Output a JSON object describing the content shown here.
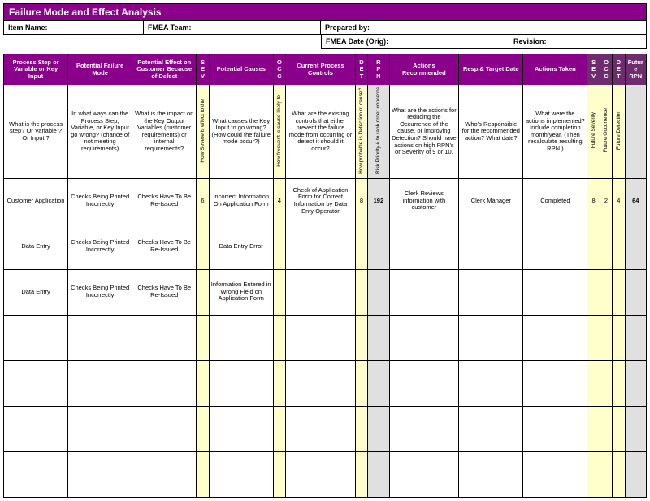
{
  "title": "Failure Mode and Effect Analysis",
  "info": {
    "item_name": "Item Name:",
    "team": "FMEA Team:",
    "prepared": "Prepared by:",
    "date": "FMEA Date (Orig):",
    "revision": "Revision:"
  },
  "headers": {
    "step": "Process Step or Variable or Key Input",
    "failure": "Potential Failure Mode",
    "effect": "Potential Effect on Customer Because of Defect",
    "sev": "S\nE\nV",
    "causes": "Potential Causes",
    "occ": "O\nC\nC",
    "controls": "Current Process Controls",
    "det": "D\nE\nT",
    "rpn": "R\nP\nN",
    "actions": "Actions Recommended",
    "resp": "Resp.& Target Date",
    "taken": "Actions Taken",
    "sev2": "S\nE\nV",
    "occ2": "O\nC\nC",
    "det2": "D\nE\nT",
    "frpn": "Future RPN"
  },
  "questions": {
    "step": "What is the process step?  Or Variable  ? Or Input  ?",
    "failure": "In what ways can the Process Step, Variable, or Key Input go wrong? (chance of not meeting requirements)",
    "effect": "What is the impact on the Key Output Variables (customer requirements) or internal requirements?",
    "sev": "How Severe is effect to the",
    "causes": "What causes the Key Input to go wrong?  (How could the failure mode occur?)",
    "occ": "How frequent is cause likely to",
    "controls": "What are the existing controls that either prevent the failure mode from occurring or detect it should it occur?",
    "det": "How probable is Detection of cause?",
    "rpn": "Risk Priority # to rank order concerns",
    "actions": "What are the actions for reducing the Occurrence of the cause, or improving Detection? Should have actions on high RPN's or Severity of 9 or 10.",
    "resp": "Who's Responsible for the recommended action? What date?",
    "taken": "What were the actions implemented?  Include completion month/year. (Then recalculate resulting RPN.)",
    "sev2": "Future Severity",
    "occ2": "Future Occurrence",
    "det2": "Future Detection"
  },
  "rows": [
    {
      "step": "Customer Application",
      "failure": "Checks Being Printed Incorrectly",
      "effect": "Checks Have To Be Re-Issued",
      "sev": "6",
      "causes": "Incorrect Information On Application Form",
      "occ": "4",
      "controls": "Check of Application Form for Correct Information by Data Enty Operator",
      "det": "8",
      "rpn": "192",
      "actions": "Clerk Reviews information with customer",
      "resp": "Clerk Manager",
      "taken": "Completed",
      "sev2": "8",
      "occ2": "2",
      "det2": "4",
      "frpn": "64"
    },
    {
      "step": "Data Entry",
      "failure": "Checks Being Printed Incorrectly",
      "effect": "Checks Have To Be Re-Issued",
      "sev": "",
      "causes": "Data Entry Error",
      "occ": "",
      "controls": "",
      "det": "",
      "rpn": "",
      "actions": "",
      "resp": "",
      "taken": "",
      "sev2": "",
      "occ2": "",
      "det2": "",
      "frpn": ""
    },
    {
      "step": "Data Entry",
      "failure": "Checks Being Printed Incorrectly",
      "effect": "Checks Have To Be Re-Issued",
      "sev": "",
      "causes": "Information Entered in Wrong Field on Application Form",
      "occ": "",
      "controls": "",
      "det": "",
      "rpn": "",
      "actions": "",
      "resp": "",
      "taken": "",
      "sev2": "",
      "occ2": "",
      "det2": "",
      "frpn": ""
    },
    {
      "step": "",
      "failure": "",
      "effect": "",
      "sev": "",
      "causes": "",
      "occ": "",
      "controls": "",
      "det": "",
      "rpn": "",
      "actions": "",
      "resp": "",
      "taken": "",
      "sev2": "",
      "occ2": "",
      "det2": "",
      "frpn": ""
    },
    {
      "step": "",
      "failure": "",
      "effect": "",
      "sev": "",
      "causes": "",
      "occ": "",
      "controls": "",
      "det": "",
      "rpn": "",
      "actions": "",
      "resp": "",
      "taken": "",
      "sev2": "",
      "occ2": "",
      "det2": "",
      "frpn": ""
    },
    {
      "step": "",
      "failure": "",
      "effect": "",
      "sev": "",
      "causes": "",
      "occ": "",
      "controls": "",
      "det": "",
      "rpn": "",
      "actions": "",
      "resp": "",
      "taken": "",
      "sev2": "",
      "occ2": "",
      "det2": "",
      "frpn": ""
    },
    {
      "step": "",
      "failure": "",
      "effect": "",
      "sev": "",
      "causes": "",
      "occ": "",
      "controls": "",
      "det": "",
      "rpn": "",
      "actions": "",
      "resp": "",
      "taken": "",
      "sev2": "",
      "occ2": "",
      "det2": "",
      "frpn": ""
    }
  ]
}
